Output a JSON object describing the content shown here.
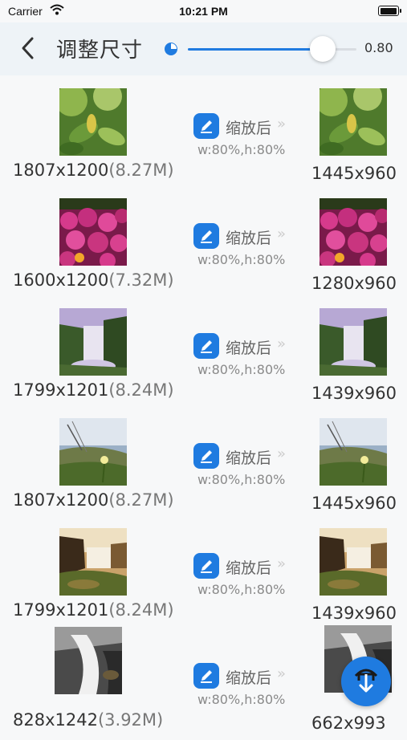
{
  "status": {
    "carrier": "Carrier",
    "time": "10:21 PM"
  },
  "nav": {
    "title": "调整尺寸",
    "scale_value": 0.8,
    "scale_label": "0.80"
  },
  "accent": "#1f7be0",
  "rows": [
    {
      "src_dims": "1807x1200",
      "src_mb": "(8.27M)",
      "action": "缩放后",
      "pct": "w:80%,h:80%",
      "dst_dims": "1445x960",
      "image": "green-leaves-photo"
    },
    {
      "src_dims": "1600x1200",
      "src_mb": "(7.32M)",
      "action": "缩放后",
      "pct": "w:80%,h:80%",
      "dst_dims": "1280x960",
      "image": "pink-flowers-photo"
    },
    {
      "src_dims": "1799x1201",
      "src_mb": "(8.24M)",
      "action": "缩放后",
      "pct": "w:80%,h:80%",
      "dst_dims": "1439x960",
      "image": "waterfall-purple-photo"
    },
    {
      "src_dims": "1807x1200",
      "src_mb": "(8.27M)",
      "action": "缩放后",
      "pct": "w:80%,h:80%",
      "dst_dims": "1445x960",
      "image": "meadow-flower-photo"
    },
    {
      "src_dims": "1799x1201",
      "src_mb": "(8.24M)",
      "action": "缩放后",
      "pct": "w:80%,h:80%",
      "dst_dims": "1439x960",
      "image": "waterfall-rocks-photo"
    },
    {
      "src_dims": "828x1242",
      "src_mb": "(3.92M)",
      "action": "缩放后",
      "pct": "w:80%,h:80%",
      "dst_dims": "662x993",
      "image": "stream-bw-photo"
    }
  ]
}
